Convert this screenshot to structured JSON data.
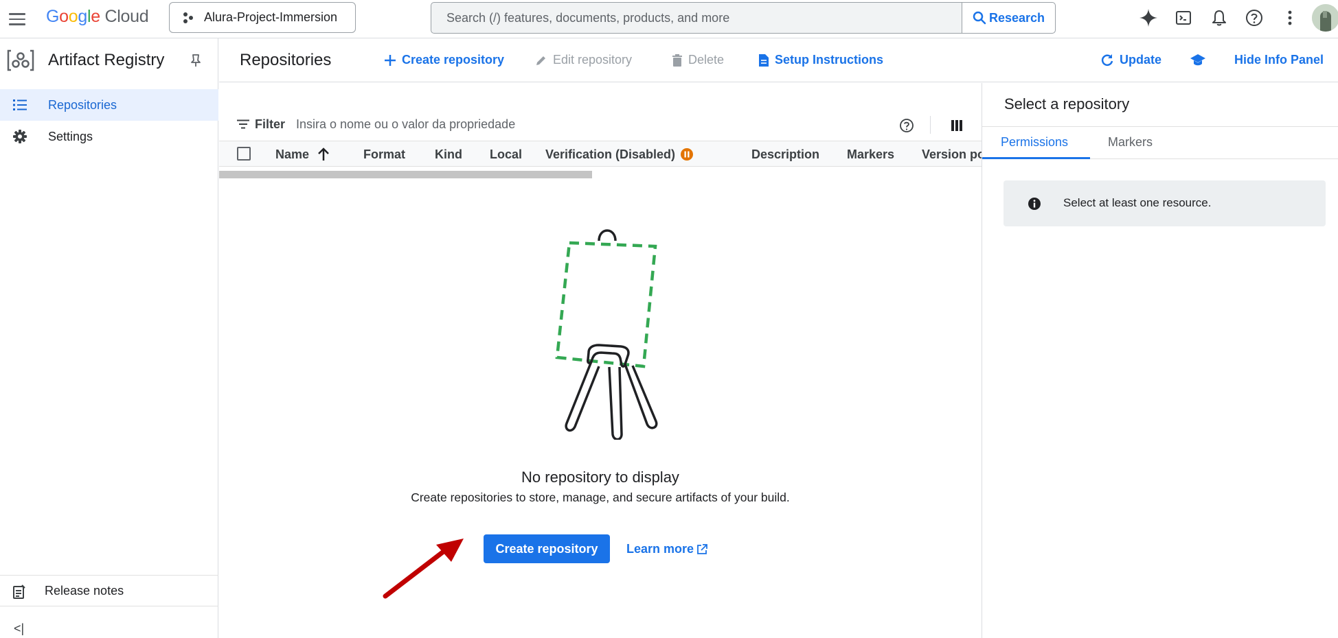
{
  "topbar": {
    "logo_google": "Google",
    "logo_cloud": "Cloud",
    "project_name": "Alura-Project-Immersion",
    "search_placeholder": "Search (/) features, documents, products, and more",
    "search_button": "Research"
  },
  "sidebar": {
    "product_title": "Artifact Registry",
    "items": [
      {
        "label": "Repositories",
        "icon": "list-icon",
        "active": true
      },
      {
        "label": "Settings",
        "icon": "gear-icon",
        "active": false
      }
    ],
    "release_notes": "Release notes"
  },
  "toolbar": {
    "title": "Repositories",
    "create": "Create repository",
    "edit": "Edit repository",
    "delete": "Delete",
    "setup": "Setup Instructions",
    "update": "Update",
    "hide_info": "Hide Info Panel"
  },
  "table": {
    "filter_label": "Filter",
    "filter_placeholder": "Insira o nome ou o valor da propriedade",
    "columns": [
      "Name",
      "Format",
      "Kind",
      "Local",
      "Verification (Disabled)",
      "Description",
      "Markers",
      "Version po"
    ]
  },
  "empty_state": {
    "title": "No repository to display",
    "subtitle": "Create repositories to store, manage, and secure artifacts of your build.",
    "primary_button": "Create repository",
    "learn_more": "Learn more"
  },
  "info_panel": {
    "title": "Select a repository",
    "tabs": [
      "Permissions",
      "Markers"
    ],
    "notice": "Select at least one resource."
  },
  "colors": {
    "accent": "#1a73e8",
    "illustration_green": "#34a853",
    "annotation_arrow": "#c00000",
    "warning_badge": "#e37400"
  }
}
